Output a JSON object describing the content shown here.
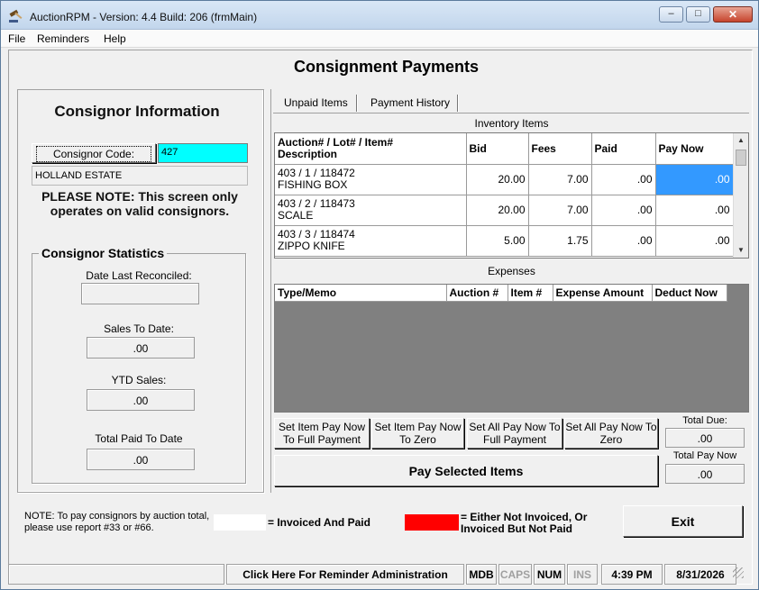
{
  "window": {
    "title": "AuctionRPM - Version: 4.4 Build: 206    (frmMain)",
    "controls": {
      "minimize": "–",
      "maximize": "□",
      "close": "✕"
    }
  },
  "menu": [
    "File",
    "Reminders",
    "Help"
  ],
  "page": {
    "title": "Consignment Payments"
  },
  "consignor": {
    "section_title": "Consignor Information",
    "code_button": "Consignor Code:",
    "code_value": "427",
    "name": "HOLLAND ESTATE",
    "note": "PLEASE NOTE: This screen only operates on valid consignors.",
    "code_color": "#00ffff"
  },
  "stats": {
    "title": "Consignor Statistics",
    "date_last_reconciled_label": "Date Last Reconciled:",
    "date_last_reconciled_value": "",
    "sales_to_date_label": "Sales To Date:",
    "sales_to_date_value": ".00",
    "ytd_sales_label": "YTD Sales:",
    "ytd_sales_value": ".00",
    "total_paid_label": "Total Paid To Date",
    "total_paid_value": ".00"
  },
  "tabs": [
    "Unpaid Items",
    "Payment History"
  ],
  "inventory": {
    "caption": "Inventory Items",
    "columns": [
      "Auction# / Lot# / Item#\nDescription",
      "Bid",
      "Fees",
      "Paid",
      "Pay Now"
    ],
    "rows": [
      {
        "id": "403 / 1 / 118472",
        "desc": "FISHING BOX",
        "bid": "20.00",
        "fees": "7.00",
        "paid": ".00",
        "pay_now": ".00",
        "selected": true
      },
      {
        "id": "403 / 2 / 118473",
        "desc": "SCALE",
        "bid": "20.00",
        "fees": "7.00",
        "paid": ".00",
        "pay_now": ".00"
      },
      {
        "id": "403 / 3 / 118474",
        "desc": "ZIPPO KNIFE",
        "bid": "5.00",
        "fees": "1.75",
        "paid": ".00",
        "pay_now": ".00"
      }
    ],
    "selected_color": "#3399ff",
    "scroll_up_icon": "triangle-up",
    "scroll_down_icon": "triangle-down"
  },
  "expenses": {
    "caption": "Expenses",
    "columns": [
      "Type/Memo",
      "Auction #",
      "Item #",
      "Expense Amount",
      "Deduct Now"
    ]
  },
  "actions": {
    "set_item_full": "Set Item Pay Now To Full Payment",
    "set_item_zero": "Set Item Pay Now To Zero",
    "set_all_full": "Set All Pay Now To Full Payment",
    "set_all_zero": "Set All Pay Now To Zero",
    "pay_selected": "Pay Selected Items"
  },
  "totals": {
    "total_due_label": "Total Due:",
    "total_due_value": ".00",
    "total_pay_now_label": "Total Pay Now",
    "total_pay_now_value": ".00"
  },
  "footer": {
    "note": "NOTE: To pay consignors by auction total, please use report #33 or #66.",
    "legend_white": "= Invoiced And Paid",
    "legend_red": "= Either Not Invoiced, Or Invoiced But Not Paid",
    "legend_red_color": "#ff0000",
    "exit": "Exit"
  },
  "statusbar": {
    "reminder": "Click Here For Reminder Administration",
    "mdb": "MDB",
    "caps": "CAPS",
    "num": "NUM",
    "ins": "INS",
    "time": "4:39 PM",
    "date": "8/31/2026"
  }
}
